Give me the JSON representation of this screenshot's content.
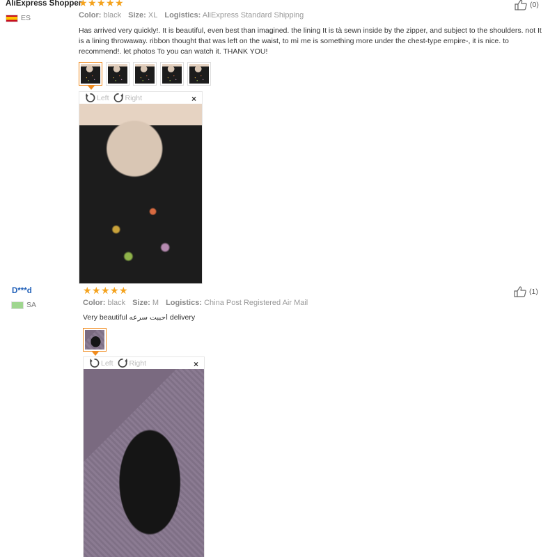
{
  "reviews": [
    {
      "user": "AliExpress Shopper",
      "country": "ES",
      "stars": 5,
      "color_label": "Color:",
      "color_value": "black",
      "size_label": "Size:",
      "size_value": "XL",
      "logistics_label": "Logistics:",
      "logistics_value": "AliExpress Standard Shipping",
      "text": "Has arrived very quickly!. It is beautiful, even best than imagined. the lining It is tà sewn inside by the zipper, and subject to the shoulders. not It is a lining throwaway. ribbon thought that was left on the waist, to mì me is something more under the chest-type empire-, it is nice. to recommend!. let photos To you can watch it. THANK YOU!",
      "helpful_count": "(0)",
      "thumbnail_count": 5,
      "viewer": {
        "left_label": "Left",
        "right_label": "Right",
        "close": "×"
      }
    },
    {
      "user": "D***d",
      "country": "SA",
      "stars": 5,
      "color_label": "Color:",
      "color_value": "black",
      "size_label": "Size:",
      "size_value": "M",
      "logistics_label": "Logistics:",
      "logistics_value": "China Post Registered Air Mail",
      "text": "Very beautiful احببت سرعه delivery",
      "helpful_count": "(1)",
      "thumbnail_count": 1,
      "viewer": {
        "left_label": "Left",
        "right_label": "Right",
        "close": "×"
      }
    }
  ],
  "colors": {
    "star": "#f4a21d",
    "thumb_active": "#f08b1e",
    "link": "#1f5fb8"
  },
  "icons": {
    "helpful": "thumbs-up-icon",
    "rotate_left": "rotate-left-icon",
    "rotate_right": "rotate-right-icon",
    "close": "close-icon"
  }
}
